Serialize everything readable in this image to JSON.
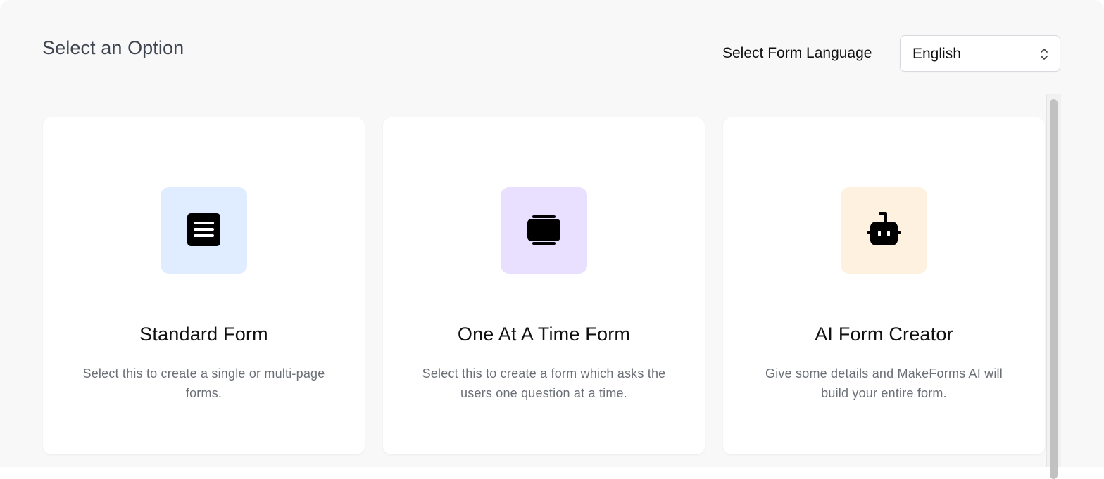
{
  "dialog": {
    "title": "Select an Option"
  },
  "language": {
    "label": "Select Form Language",
    "selected": "English"
  },
  "options": [
    {
      "title": "Standard Form",
      "description": "Select this to create a single or multi-page forms.",
      "icon": "document-list-icon",
      "tile_color": "#e0ecff"
    },
    {
      "title": "One At A Time Form",
      "description": "Select this to create a form which asks the users one question at a time.",
      "icon": "stacked-cards-icon",
      "tile_color": "#e9e0ff"
    },
    {
      "title": "AI Form Creator",
      "description": "Give some details and MakeForms AI will build your entire form.",
      "icon": "robot-icon",
      "tile_color": "#fff1df"
    }
  ]
}
